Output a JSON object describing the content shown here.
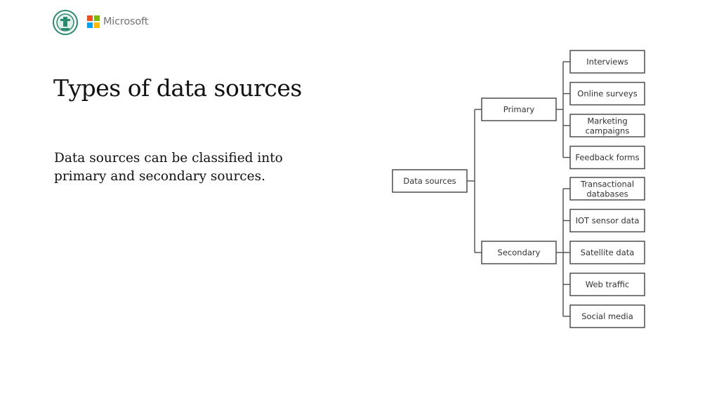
{
  "header": {
    "emblem_icon": "cbse-emblem-icon",
    "brand_logo_icon": "microsoft-logo-icon",
    "brand_name": "Microsoft",
    "brand_colors": [
      "#f25022",
      "#7fba00",
      "#00a4ef",
      "#ffb900"
    ]
  },
  "slide": {
    "title": "Types of data sources",
    "body": "Data sources can be classified into primary and secondary sources."
  },
  "diagram": {
    "root": "Data sources",
    "branches": [
      {
        "label": "Primary",
        "children": [
          "Interviews",
          "Online surveys",
          "Marketing|campaigns",
          "Feedback forms"
        ]
      },
      {
        "label": "Secondary",
        "children": [
          "Transactional|databases",
          "IOT sensor data",
          "Satellite data",
          "Web traffic",
          "Social media"
        ]
      }
    ]
  }
}
